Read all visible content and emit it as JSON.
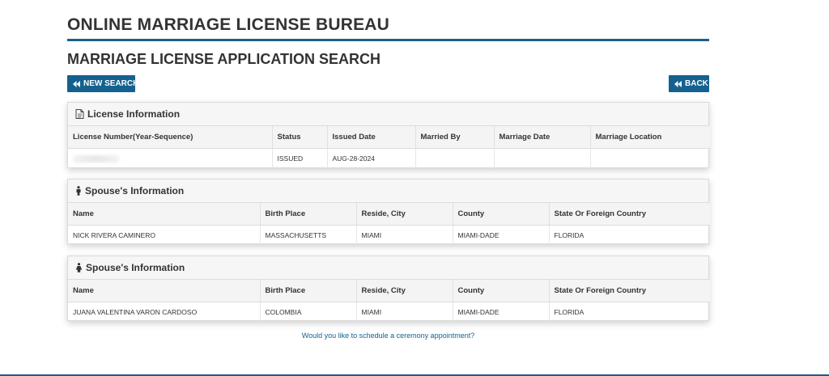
{
  "header": {
    "bureau_title": "ONLINE MARRIAGE LICENSE BUREAU",
    "page_title": "MARRIAGE LICENSE APPLICATION SEARCH"
  },
  "toolbar": {
    "new_search_label": "NEW SEARCH",
    "back_label": "BACK"
  },
  "license_panel": {
    "title": "License Information",
    "columns": [
      "License Number(Year-Sequence)",
      "Status",
      "Issued Date",
      "Married By",
      "Marriage Date",
      "Marriage Location"
    ],
    "row": {
      "license_number": "",
      "status": "ISSUED",
      "issued_date": "AUG-28-2024",
      "married_by": "",
      "marriage_date": "",
      "marriage_location": ""
    }
  },
  "spouse1_panel": {
    "title": "Spouse's Information",
    "columns": [
      "Name",
      "Birth Place",
      "Reside, City",
      "County",
      "State Or Foreign Country"
    ],
    "row": [
      "NICK RIVERA CAMINERO",
      "MASSACHUSETTS",
      "MIAMI",
      "MIAMI-DADE",
      "FLORIDA"
    ]
  },
  "spouse2_panel": {
    "title": "Spouse's Information",
    "columns": [
      "Name",
      "Birth Place",
      "Reside, City",
      "County",
      "State Or Foreign Country"
    ],
    "row": [
      "JUANA VALENTINA VARON CARDOSO",
      "COLOMBIA",
      "MIAMI",
      "MIAMI-DADE",
      "FLORIDA"
    ]
  },
  "footer": {
    "ceremony_link": "Would you like to schedule a ceremony appointment?"
  },
  "icons": {
    "new_search": "rewind-icon",
    "back": "rewind-icon",
    "license": "document-icon",
    "spouse1": "male-person-icon",
    "spouse2": "female-person-icon"
  },
  "colors": {
    "accent": "#14618f",
    "rule": "#1e5f86",
    "panel_header_bg": "#f6f6f6"
  }
}
